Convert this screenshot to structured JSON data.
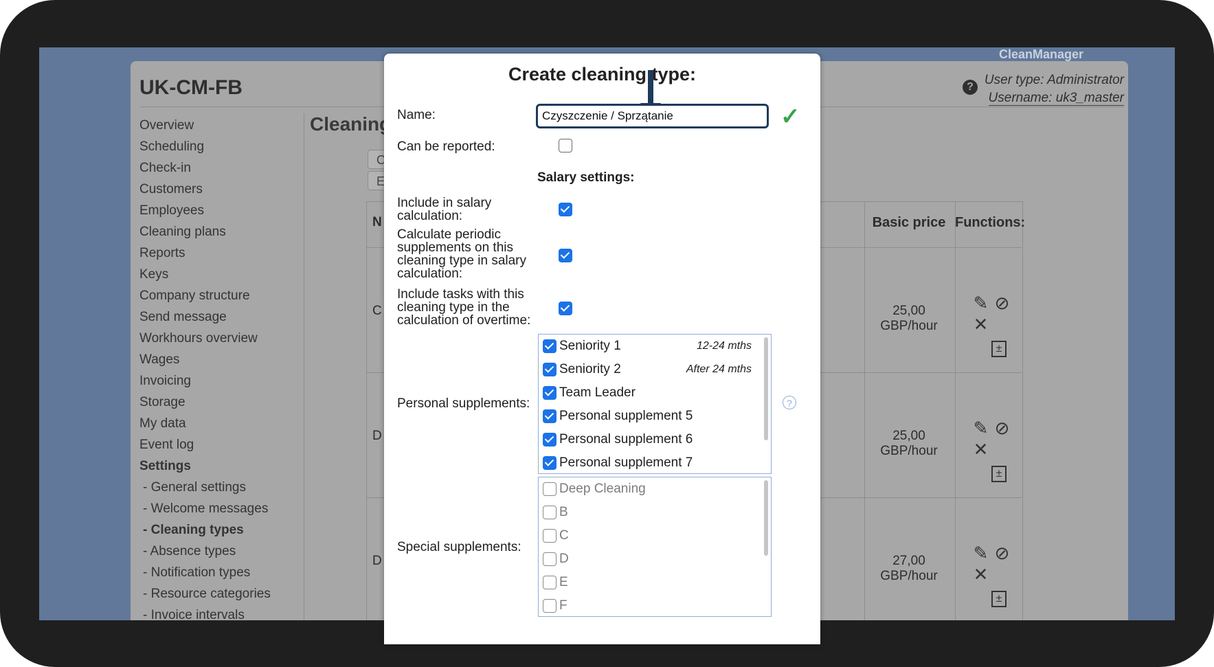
{
  "app": {
    "brand": "CleanManager",
    "title": "UK-CM-FB",
    "user_type": "User type: Administrator",
    "username": "Username: uk3_master",
    "help_icon_glyph": "?"
  },
  "menu": [
    {
      "label": "Overview"
    },
    {
      "label": "Scheduling"
    },
    {
      "label": "Check-in"
    },
    {
      "label": "Customers"
    },
    {
      "label": "Employees"
    },
    {
      "label": "Cleaning plans"
    },
    {
      "label": "Reports"
    },
    {
      "label": "Keys"
    },
    {
      "label": "Company structure"
    },
    {
      "label": "Send message"
    },
    {
      "label": "Workhours overview"
    },
    {
      "label": "Wages"
    },
    {
      "label": "Invoicing"
    },
    {
      "label": "Storage"
    },
    {
      "label": "My data"
    },
    {
      "label": "Event log"
    },
    {
      "label": "Settings"
    },
    {
      "label": "- General settings"
    },
    {
      "label": "- Welcome messages"
    },
    {
      "label": "- Cleaning types"
    },
    {
      "label": "- Absence types"
    },
    {
      "label": "- Notification types"
    },
    {
      "label": "- Resource categories"
    },
    {
      "label": "- Invoice intervals"
    }
  ],
  "content": {
    "title": "Cleaning",
    "btn1": "C",
    "btn2": "E",
    "table": {
      "col_name_partial": "N",
      "basic_price_header": "Basic price",
      "functions_header": "Functions:",
      "rows": [
        {
          "name_partial": "C",
          "price": "25,00 GBP/hour"
        },
        {
          "name_partial": "D",
          "price": "25,00 GBP/hour"
        },
        {
          "name_partial": "D",
          "price": "27,00 GBP/hour"
        }
      ]
    }
  },
  "modal": {
    "title": "Create cleaning type:",
    "name_label": "Name:",
    "name_value": "Czyszczenie / Sprzątanie",
    "can_be_reported_label": "Can be reported:",
    "salary_settings_header": "Salary settings:",
    "include_salary_label": "Include in salary calculation:",
    "periodic_label": "Calculate periodic supplements on this cleaning type in salary calculation:",
    "overtime_label": "Include tasks with this cleaning type in the calculation of overtime:",
    "personal_supplements_label": "Personal supplements:",
    "special_supplements_label": "Special supplements:",
    "personal_supplements": [
      {
        "label": "Seniority 1",
        "note": "12-24 mths"
      },
      {
        "label": "Seniority 2",
        "note": "After 24 mths"
      },
      {
        "label": "Team Leader",
        "note": ""
      },
      {
        "label": "Personal supplement 5",
        "note": ""
      },
      {
        "label": "Personal supplement 6",
        "note": ""
      },
      {
        "label": "Personal supplement 7",
        "note": ""
      }
    ],
    "special_supplements": [
      {
        "label": "Deep Cleaning"
      },
      {
        "label": "B"
      },
      {
        "label": "C"
      },
      {
        "label": "D"
      },
      {
        "label": "E"
      },
      {
        "label": "F"
      }
    ],
    "help_glyph": "?"
  },
  "icons": {
    "edit": "pencil-icon",
    "hide": "eye-slash-icon",
    "delete": "close-icon",
    "calc": "calculator-icon",
    "ok": "checkmark-icon",
    "arrow": "arrow-down-icon"
  },
  "colors": {
    "accent_checkbox": "#1a73e8",
    "input_border": "#1f3a5a",
    "ok_green": "#3aa34a",
    "overlay_bg": "#61789a"
  }
}
